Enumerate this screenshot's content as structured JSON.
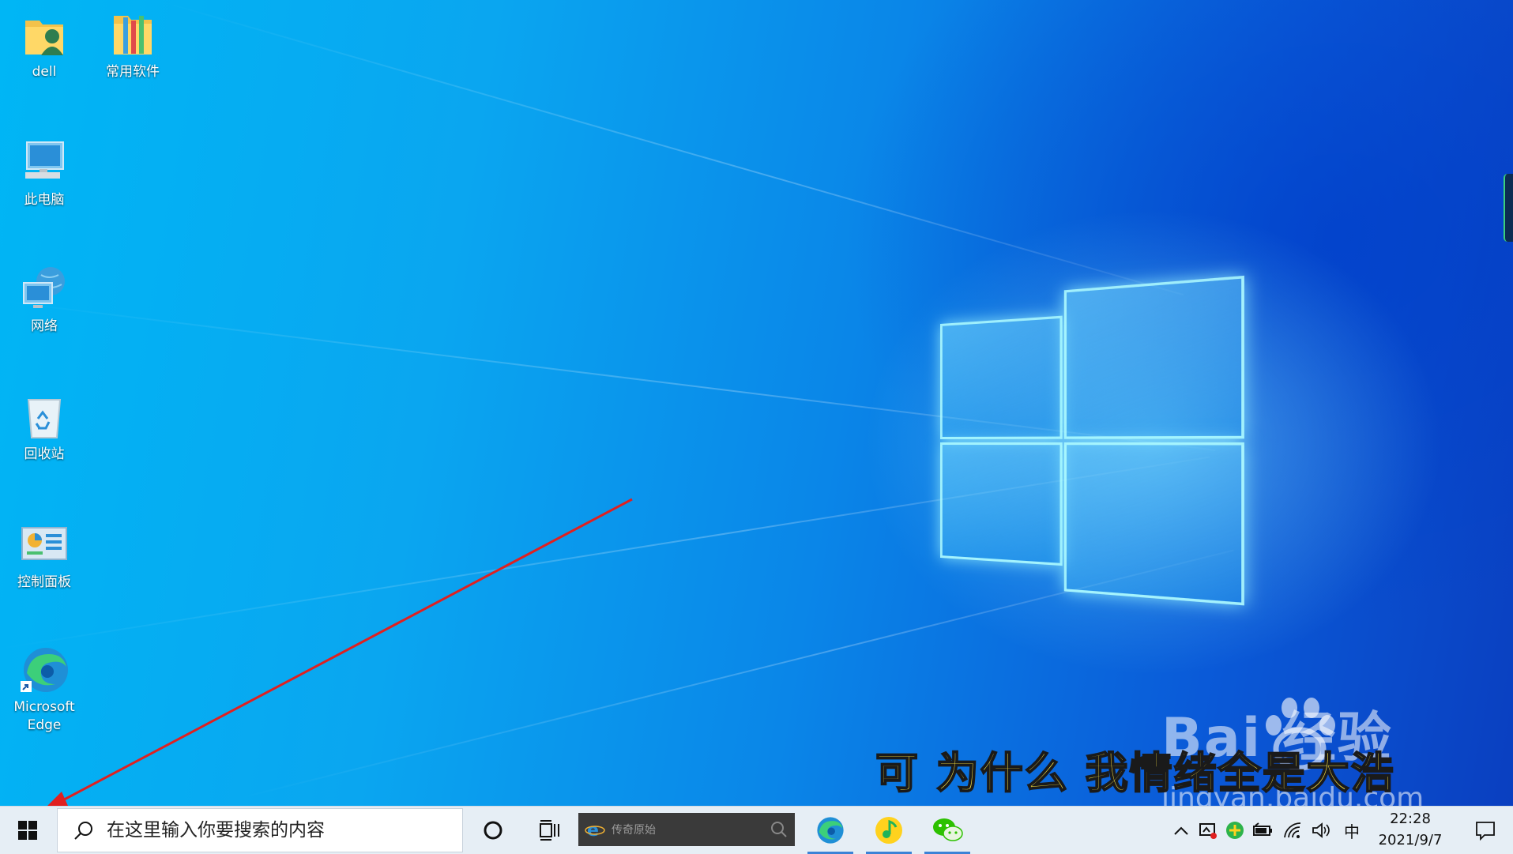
{
  "desktop": {
    "icons": [
      {
        "label": "dell",
        "icon": "user-folder-icon"
      },
      {
        "label": "常用软件",
        "icon": "folder-icon"
      },
      {
        "label": "此电脑",
        "icon": "computer-icon"
      },
      {
        "label": "网络",
        "icon": "network-icon"
      },
      {
        "label": "回收站",
        "icon": "recycle-bin-icon"
      },
      {
        "label": "控制面板",
        "icon": "control-panel-icon"
      },
      {
        "label": "Microsoft\nEdge",
        "icon": "edge-icon"
      }
    ],
    "subtitle": "可 为什么 我情绪全是大浩",
    "watermark": {
      "brand": "Bai  经验",
      "url": "jingyan.baidu.com"
    }
  },
  "taskbar": {
    "start": {
      "icon": "windows-start-icon"
    },
    "search": {
      "placeholder": "在这里输入你要搜索的内容",
      "icon": "search-icon"
    },
    "cortana": {
      "icon": "cortana-circle-icon"
    },
    "task_view": {
      "icon": "task-view-icon"
    },
    "mini_browser": {
      "text": "传奇原始",
      "icon": "ie-icon"
    },
    "pinned": [
      {
        "name": "edge",
        "icon": "edge-icon"
      },
      {
        "name": "qq-music",
        "icon": "qq-music-icon"
      },
      {
        "name": "wechat",
        "icon": "wechat-icon"
      }
    ],
    "tray": {
      "ime": "中",
      "time": "22:28",
      "date": "2021/9/7"
    }
  },
  "colors": {
    "taskbar_bg": "#e6eef5",
    "subtitle": "#ffe640",
    "arrow": "#e02020"
  }
}
